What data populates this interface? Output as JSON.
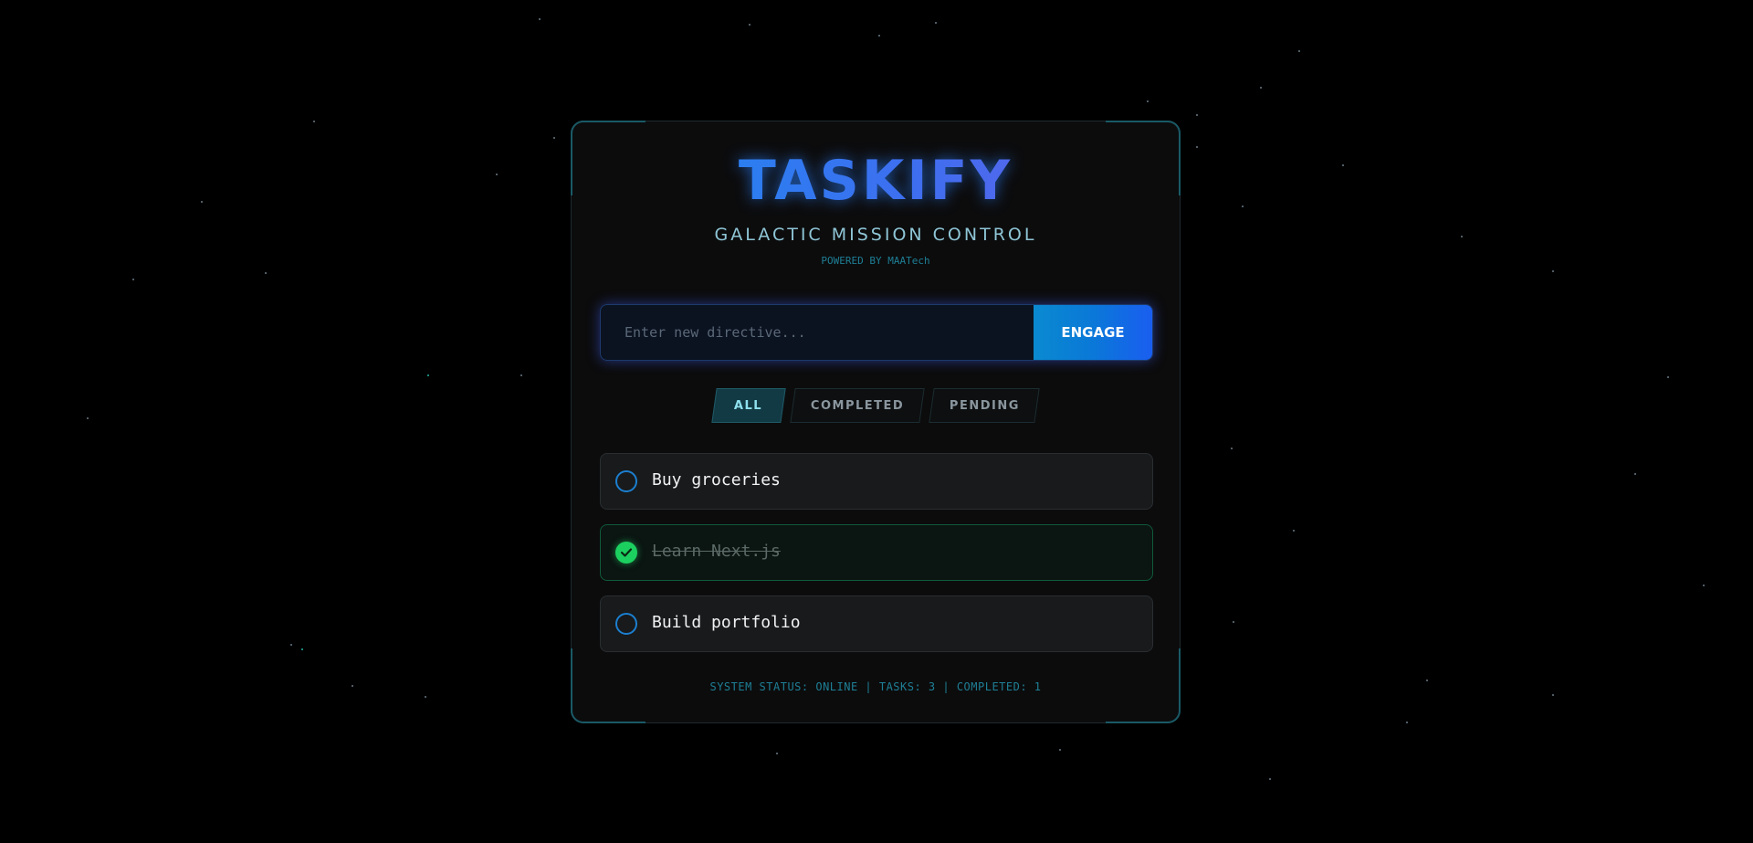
{
  "app": {
    "title": "TASKIFY",
    "subtitle": "GALACTIC MISSION CONTROL",
    "powered_by": "POWERED BY MAATech"
  },
  "input": {
    "value": "",
    "placeholder": "Enter new directive..."
  },
  "engage_label": "ENGAGE",
  "filters": [
    {
      "label": "ALL",
      "active": true
    },
    {
      "label": "COMPLETED",
      "active": false
    },
    {
      "label": "PENDING",
      "active": false
    }
  ],
  "tasks": [
    {
      "text": "Buy groceries",
      "completed": false
    },
    {
      "text": "Learn Next.js",
      "completed": true
    },
    {
      "text": "Build portfolio",
      "completed": false
    }
  ],
  "status_text": "SYSTEM STATUS: ONLINE | TASKS: 3 | COMPLETED: 1",
  "colors": {
    "background": "#000000",
    "accent": "#1a8cf0",
    "teal": "#1e7f95",
    "complete": "#1cd060"
  },
  "icons": {
    "check": "check-icon",
    "unchecked": "circle-icon"
  }
}
